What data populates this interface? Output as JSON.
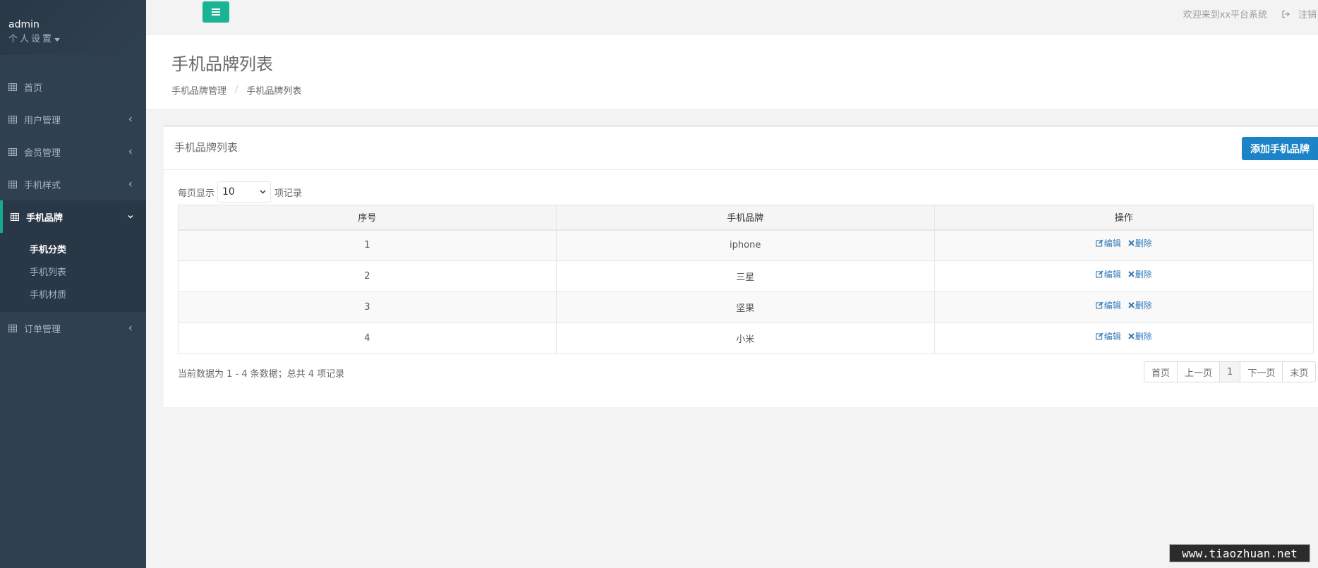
{
  "sidebar": {
    "user_name": "admin",
    "user_settings": "个人设置",
    "items": [
      {
        "label": "首页"
      },
      {
        "label": "用户管理"
      },
      {
        "label": "会员管理"
      },
      {
        "label": "手机样式"
      },
      {
        "label": "手机品牌"
      },
      {
        "label": "订单管理"
      }
    ],
    "submenu": [
      {
        "label": "手机分类"
      },
      {
        "label": "手机列表"
      },
      {
        "label": "手机材质"
      }
    ]
  },
  "topbar": {
    "welcome": "欢迎来到xx平台系统",
    "logout": "注销"
  },
  "heading": {
    "title": "手机品牌列表",
    "breadcrumb": [
      "手机品牌管理",
      "手机品牌列表"
    ]
  },
  "panel": {
    "title": "手机品牌列表",
    "add_button": "添加手机品牌",
    "length_prefix": "每页显示",
    "length_value": "10",
    "length_suffix": "项记录",
    "columns": [
      "序号",
      "手机品牌",
      "操作"
    ],
    "rows": [
      {
        "id": "1",
        "brand": "iphone"
      },
      {
        "id": "2",
        "brand": "三星"
      },
      {
        "id": "3",
        "brand": "坚果"
      },
      {
        "id": "4",
        "brand": "小米"
      }
    ],
    "edit_label": "编辑",
    "delete_label": "删除",
    "info": "当前数据为 1 - 4 条数据；总共 4 项记录",
    "pager": [
      "首页",
      "上一页",
      "1",
      "下一页",
      "末页"
    ]
  },
  "watermark": "www.tiaozhuan.net",
  "colors": {
    "sidebar_bg": "#2f4050",
    "primary": "#1ab394",
    "link": "#337ab7",
    "button": "#1c84c6"
  }
}
